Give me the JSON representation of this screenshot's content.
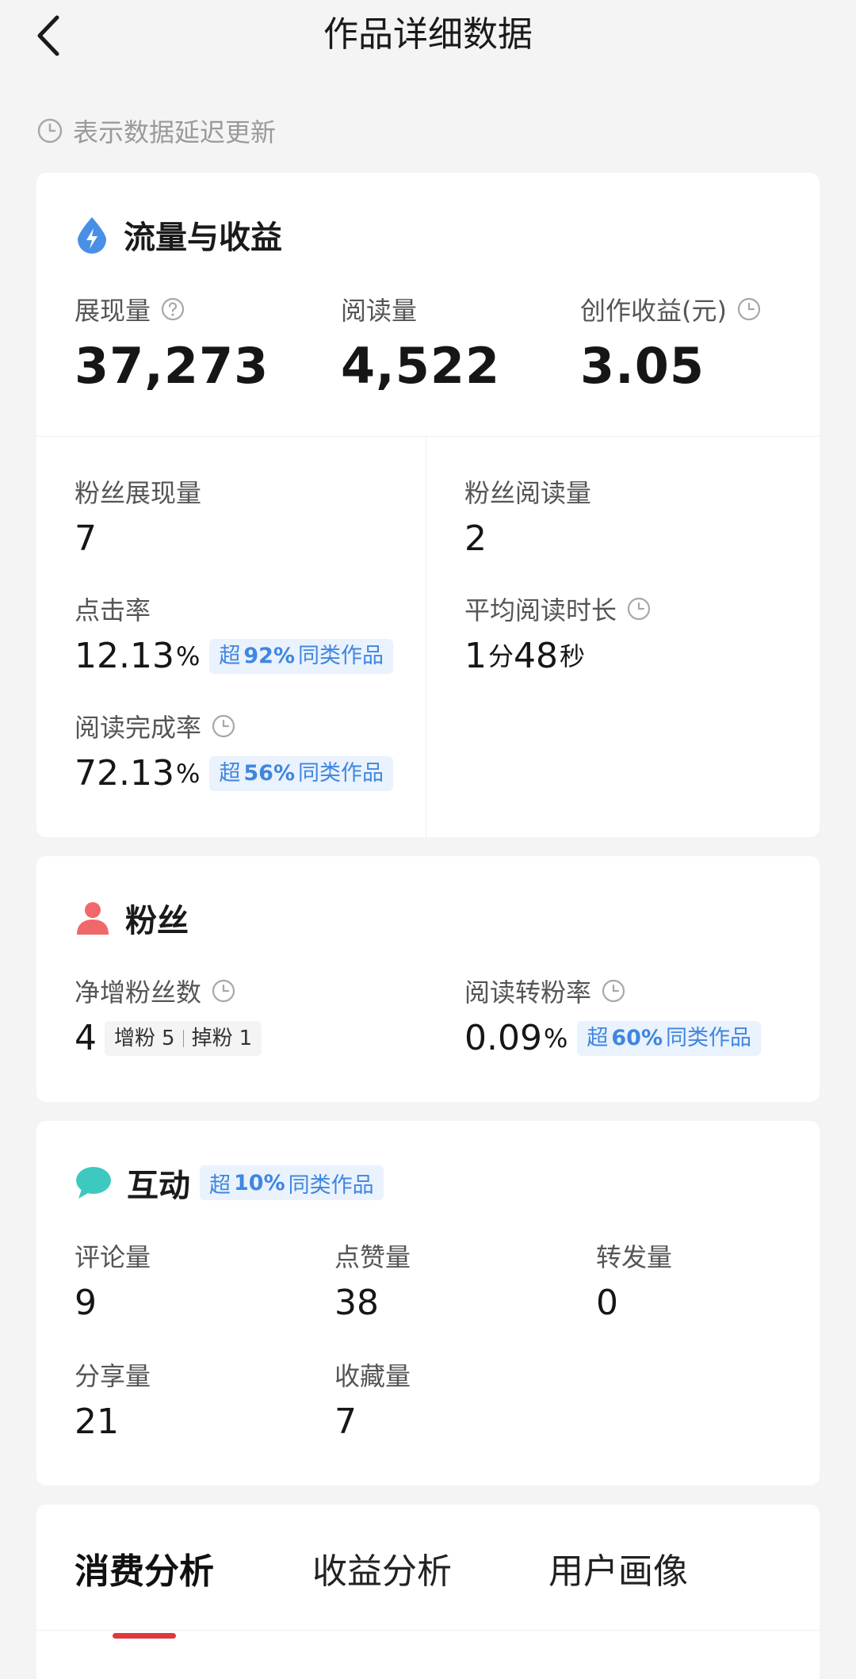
{
  "header": {
    "title": "作品详细数据",
    "notice": "表示数据延迟更新"
  },
  "traffic": {
    "title": "流量与收益",
    "impressions": {
      "label": "展现量",
      "value": "37,273"
    },
    "reads": {
      "label": "阅读量",
      "value": "4,522"
    },
    "earnings": {
      "label": "创作收益(元)",
      "value": "3.05"
    },
    "fan_impressions": {
      "label": "粉丝展现量",
      "value": "7"
    },
    "fan_reads": {
      "label": "粉丝阅读量",
      "value": "2"
    },
    "ctr": {
      "label": "点击率",
      "value": "12.13",
      "unit": "%",
      "badge_prefix": "超",
      "badge_pct": "92%",
      "badge_suffix": "同类作品"
    },
    "avg_read_time": {
      "label": "平均阅读时长",
      "minutes": "1",
      "min_unit": "分",
      "seconds": "48",
      "sec_unit": "秒"
    },
    "completion": {
      "label": "阅读完成率",
      "value": "72.13",
      "unit": "%",
      "badge_prefix": "超",
      "badge_pct": "56%",
      "badge_suffix": "同类作品"
    }
  },
  "fans": {
    "title": "粉丝",
    "net_gain": {
      "label": "净增粉丝数",
      "value": "4",
      "gain_label": "增粉",
      "gain_value": "5",
      "loss_label": "掉粉",
      "loss_value": "1"
    },
    "conversion": {
      "label": "阅读转粉率",
      "value": "0.09",
      "unit": "%",
      "badge_prefix": "超",
      "badge_pct": "60%",
      "badge_suffix": "同类作品"
    }
  },
  "interaction": {
    "title": "互动",
    "badge_prefix": "超",
    "badge_pct": "10%",
    "badge_suffix": "同类作品",
    "comments": {
      "label": "评论量",
      "value": "9"
    },
    "likes": {
      "label": "点赞量",
      "value": "38"
    },
    "reposts": {
      "label": "转发量",
      "value": "0"
    },
    "shares": {
      "label": "分享量",
      "value": "21"
    },
    "favorites": {
      "label": "收藏量",
      "value": "7"
    }
  },
  "tabs": {
    "consumption": "消费分析",
    "revenue": "收益分析",
    "audience": "用户画像"
  },
  "colors": {
    "accent_red": "#e0383e",
    "badge_blue": "#3f86e0",
    "badge_bg": "#eaf2fd",
    "traffic_icon": "#4a8fe6",
    "fans_icon": "#f0686a",
    "interaction_icon": "#3dc9c0"
  },
  "icons": {
    "back": "back-arrow-icon",
    "clock": "clock-icon",
    "help": "question-circle-icon",
    "traffic": "lightning-drop-icon",
    "fans": "user-icon",
    "interaction": "chat-bubble-icon"
  }
}
